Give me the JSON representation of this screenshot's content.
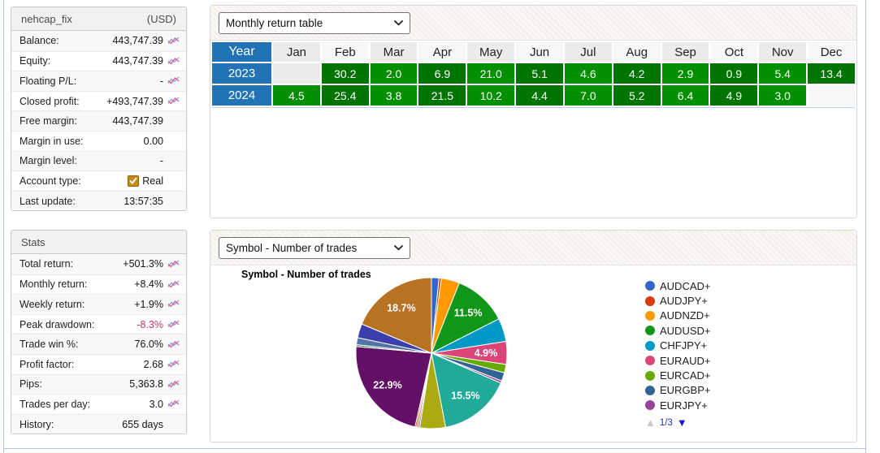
{
  "account": {
    "title": "nehcap_fix",
    "currency": "(USD)",
    "rows": [
      {
        "label": "Balance:",
        "value": "443,747.39",
        "icon": true,
        "negative": false,
        "checkbox": false
      },
      {
        "label": "Equity:",
        "value": "443,747.39",
        "icon": true,
        "negative": false,
        "checkbox": false
      },
      {
        "label": "Floating P/L:",
        "value": "-",
        "icon": true,
        "negative": false,
        "checkbox": false
      },
      {
        "label": "Closed profit:",
        "value": "+493,747.39",
        "icon": true,
        "negative": false,
        "checkbox": false
      },
      {
        "label": "Free margin:",
        "value": "443,747.39",
        "icon": false,
        "negative": false,
        "checkbox": false
      },
      {
        "label": "Margin in use:",
        "value": "0.00",
        "icon": false,
        "negative": false,
        "checkbox": false
      },
      {
        "label": "Margin level:",
        "value": "-",
        "icon": false,
        "negative": false,
        "checkbox": false
      },
      {
        "label": "Account type:",
        "value": "Real",
        "icon": false,
        "negative": false,
        "checkbox": true
      },
      {
        "label": "Last update:",
        "value": "13:57:35",
        "icon": false,
        "negative": false,
        "checkbox": false
      }
    ]
  },
  "stats": {
    "title": "Stats",
    "rows": [
      {
        "label": "Total return:",
        "value": "+501.3%",
        "icon": true,
        "negative": false,
        "checkbox": false
      },
      {
        "label": "Monthly return:",
        "value": "+8.4%",
        "icon": true,
        "negative": false,
        "checkbox": false
      },
      {
        "label": "Weekly return:",
        "value": "+1.9%",
        "icon": true,
        "negative": false,
        "checkbox": false
      },
      {
        "label": "Peak drawdown:",
        "value": "-8.3%",
        "icon": true,
        "negative": true,
        "checkbox": false
      },
      {
        "label": "Trade win %:",
        "value": "76.0%",
        "icon": true,
        "negative": false,
        "checkbox": false
      },
      {
        "label": "Profit factor:",
        "value": "2.68",
        "icon": true,
        "negative": false,
        "checkbox": false
      },
      {
        "label": "Pips:",
        "value": "5,363.8",
        "icon": true,
        "negative": false,
        "checkbox": false
      },
      {
        "label": "Trades per day:",
        "value": "3.0",
        "icon": true,
        "negative": false,
        "checkbox": false
      },
      {
        "label": "History:",
        "value": "655 days",
        "icon": false,
        "negative": false,
        "checkbox": false
      }
    ]
  },
  "monthly_widget": {
    "dropdown_value": "Monthly return table"
  },
  "symbol_widget": {
    "dropdown_value": "Symbol - Number of trades",
    "pager": {
      "up": "▲",
      "label": "1/3",
      "down": "▼"
    }
  },
  "chart_data": [
    {
      "type": "table",
      "title": "Monthly return table",
      "columns": [
        "Year",
        "Jan",
        "Feb",
        "Mar",
        "Apr",
        "May",
        "Jun",
        "Jul",
        "Aug",
        "Sep",
        "Oct",
        "Nov",
        "Dec"
      ],
      "rows": [
        {
          "year": "2023",
          "values": [
            "",
            "30.2",
            "2.0",
            "6.9",
            "21.0",
            "5.1",
            "4.6",
            "4.2",
            "2.9",
            "0.9",
            "5.4",
            "13.4"
          ]
        },
        {
          "year": "2024",
          "values": [
            "4.5",
            "25.4",
            "3.8",
            "21.5",
            "10.2",
            "4.4",
            "7.0",
            "5.2",
            "6.4",
            "4.9",
            "3.0",
            ""
          ]
        }
      ],
      "header_color": "#2273B5",
      "positive_color": "#008F00"
    },
    {
      "type": "pie",
      "title": "Symbol - Number of trades",
      "legend_position": "right",
      "slices": [
        {
          "symbol": "AUDCAD+",
          "color": "#3366CC",
          "value": 1.6,
          "label": ""
        },
        {
          "symbol": "AUDJPY+",
          "color": "#DC3912",
          "value": 0.5,
          "label": ""
        },
        {
          "symbol": "AUDNZD+",
          "color": "#FF9900",
          "value": 3.9,
          "label": ""
        },
        {
          "symbol": "AUDUSD+",
          "color": "#109618",
          "value": 11.5,
          "label": "11.5%"
        },
        {
          "symbol": "CHFJPY+",
          "color": "#0099C6",
          "value": 5.0,
          "label": ""
        },
        {
          "symbol": "EURAUD+",
          "color": "#DD4477",
          "value": 4.9,
          "label": "4.9%"
        },
        {
          "symbol": "EURCAD+",
          "color": "#66AA00",
          "value": 1.8,
          "label": ""
        },
        {
          "symbol": "EURGBP+",
          "color": "#316395",
          "value": 1.8,
          "label": ""
        },
        {
          "symbol": "EURJPY+",
          "color": "#994499",
          "value": 0.5,
          "label": ""
        },
        {
          "symbol": "",
          "color": "#22AA99",
          "value": 15.5,
          "label": "15.5%"
        },
        {
          "symbol": "",
          "color": "#AAAA11",
          "value": 5.5,
          "label": ""
        },
        {
          "symbol": "",
          "color": "#6633CC",
          "value": 0.3,
          "label": ""
        },
        {
          "symbol": "",
          "color": "#E67300",
          "value": 0.4,
          "label": ""
        },
        {
          "symbol": "",
          "color": "#8B0707",
          "value": 0.3,
          "label": ""
        },
        {
          "symbol": "",
          "color": "#651067",
          "value": 22.9,
          "label": "22.9%"
        },
        {
          "symbol": "",
          "color": "#329262",
          "value": 0.4,
          "label": ""
        },
        {
          "symbol": "",
          "color": "#5574A6",
          "value": 1.5,
          "label": ""
        },
        {
          "symbol": "",
          "color": "#3B3EAC",
          "value": 3.0,
          "label": ""
        },
        {
          "symbol": "",
          "color": "#B77322",
          "value": 18.7,
          "label": "18.7%"
        }
      ],
      "legend_visible_symbols": [
        {
          "name": "AUDCAD+",
          "color": "#3366CC"
        },
        {
          "name": "AUDJPY+",
          "color": "#DC3912"
        },
        {
          "name": "AUDNZD+",
          "color": "#FF9900"
        },
        {
          "name": "AUDUSD+",
          "color": "#109618"
        },
        {
          "name": "CHFJPY+",
          "color": "#0099C6"
        },
        {
          "name": "EURAUD+",
          "color": "#DD4477"
        },
        {
          "name": "EURCAD+",
          "color": "#66AA00"
        },
        {
          "name": "EURGBP+",
          "color": "#316395"
        },
        {
          "name": "EURJPY+",
          "color": "#994499"
        }
      ]
    }
  ]
}
